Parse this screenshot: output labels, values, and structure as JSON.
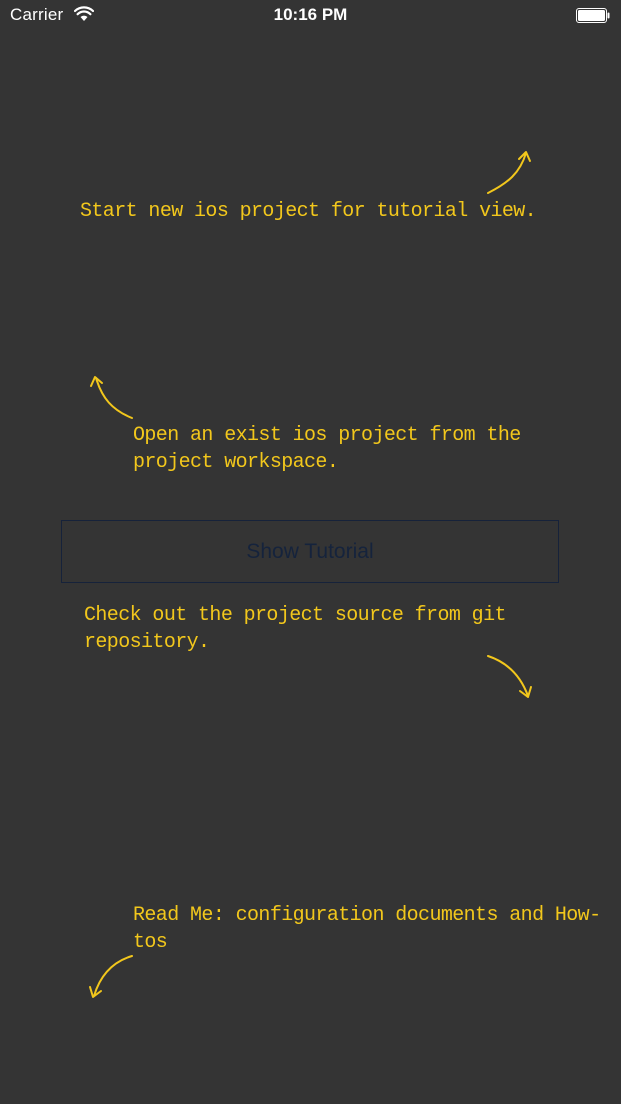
{
  "status_bar": {
    "carrier": "Carrier",
    "time": "10:16 PM"
  },
  "hints": {
    "new_project": "Start new ios project for tutorial view.",
    "open_project": "Open an exist ios project from the project workspace.",
    "checkout_git": "Check out the project source from git repository.",
    "read_me": "Read Me: configuration documents and How-tos"
  },
  "buttons": {
    "show_tutorial": "Show Tutorial"
  },
  "colors": {
    "background": "#343434",
    "hint_text": "#f2c71c",
    "button_text": "#15233c",
    "button_border": "#16223a"
  },
  "icons": {
    "wifi": "wifi-icon",
    "battery": "battery-icon",
    "arrow": "curved-arrow-icon"
  }
}
